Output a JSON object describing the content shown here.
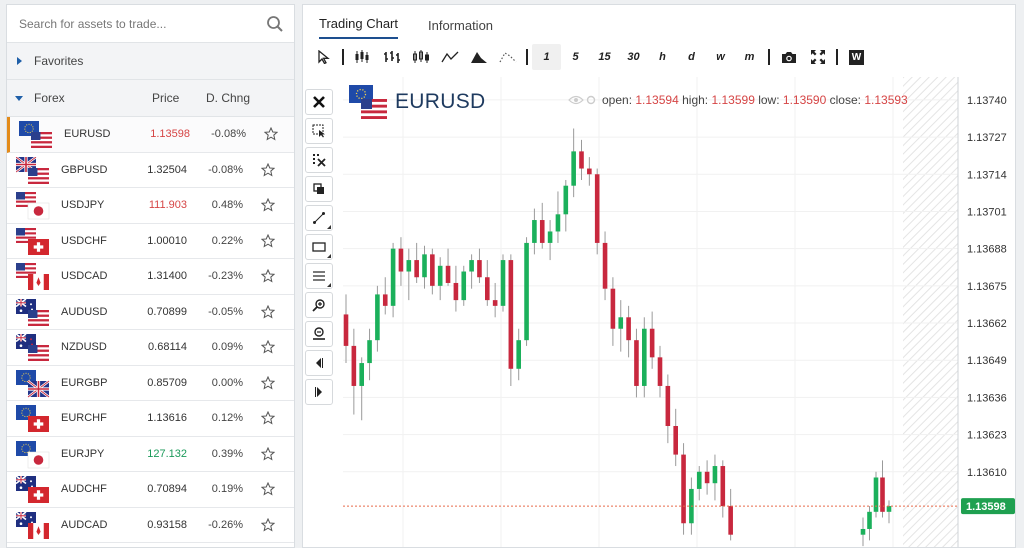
{
  "search": {
    "placeholder": "Search for assets to trade..."
  },
  "favorites_label": "Favorites",
  "forex": {
    "label": "Forex",
    "col_price": "Price",
    "col_change": "D. Chng",
    "rows": [
      {
        "symbol": "EURUSD",
        "price": "1.13598",
        "change": "-0.08%",
        "price_color": "red",
        "base": "EU",
        "quote": "US"
      },
      {
        "symbol": "GBPUSD",
        "price": "1.32504",
        "change": "-0.08%",
        "price_color": "none",
        "base": "GB",
        "quote": "US"
      },
      {
        "symbol": "USDJPY",
        "price": "111.903",
        "change": "0.48%",
        "price_color": "red",
        "base": "US",
        "quote": "JP"
      },
      {
        "symbol": "USDCHF",
        "price": "1.00010",
        "change": "0.22%",
        "price_color": "none",
        "base": "US",
        "quote": "CH"
      },
      {
        "symbol": "USDCAD",
        "price": "1.31400",
        "change": "-0.23%",
        "price_color": "none",
        "base": "US",
        "quote": "CA"
      },
      {
        "symbol": "AUDUSD",
        "price": "0.70899",
        "change": "-0.05%",
        "price_color": "none",
        "base": "AU",
        "quote": "US"
      },
      {
        "symbol": "NZDUSD",
        "price": "0.68114",
        "change": "0.09%",
        "price_color": "none",
        "base": "NZ",
        "quote": "US"
      },
      {
        "symbol": "EURGBP",
        "price": "0.85709",
        "change": "0.00%",
        "price_color": "none",
        "base": "EU",
        "quote": "GB"
      },
      {
        "symbol": "EURCHF",
        "price": "1.13616",
        "change": "0.12%",
        "price_color": "none",
        "base": "EU",
        "quote": "CH"
      },
      {
        "symbol": "EURJPY",
        "price": "127.132",
        "change": "0.39%",
        "price_color": "green",
        "base": "EU",
        "quote": "JP"
      },
      {
        "symbol": "AUDCHF",
        "price": "0.70894",
        "change": "0.19%",
        "price_color": "none",
        "base": "AU",
        "quote": "CH"
      },
      {
        "symbol": "AUDCAD",
        "price": "0.93158",
        "change": "-0.26%",
        "price_color": "none",
        "base": "AU",
        "quote": "CA"
      }
    ]
  },
  "tabs": [
    {
      "label": "Trading Chart",
      "active": true
    },
    {
      "label": "Information",
      "active": false
    }
  ],
  "toolbar": {
    "intervals": [
      "1",
      "5",
      "15",
      "30",
      "h",
      "d",
      "w",
      "m"
    ],
    "selected_interval": "1",
    "chart_types": [
      "candles-icon",
      "bars-icon",
      "hollow-candles-icon",
      "line-icon",
      "area-icon",
      "dotted-line-icon"
    ],
    "w_label": "W"
  },
  "chart_header": {
    "symbol": "EURUSD",
    "open_label": "open:",
    "open": "1.13594",
    "high_label": "high:",
    "high": "1.13599",
    "low_label": "low:",
    "low": "1.13590",
    "close_label": "close:",
    "close": "1.13593"
  },
  "colors": {
    "up": "#1bb05b",
    "down": "#c8283e",
    "current_price": "#1fa050",
    "accent": "#e38b1a"
  },
  "chart_data": {
    "type": "candlestick",
    "y_ticks": [
      "1.13740",
      "1.13727",
      "1.13714",
      "1.13701",
      "1.13688",
      "1.13675",
      "1.13662",
      "1.13649",
      "1.13636",
      "1.13623",
      "1.13610"
    ],
    "ylim": [
      1.13583,
      1.13748
    ],
    "current_price": "1.13598",
    "grid": true,
    "candles": [
      [
        1.13665,
        1.13672,
        1.13648,
        1.13654
      ],
      [
        1.13654,
        1.1366,
        1.1363,
        1.1364
      ],
      [
        1.1364,
        1.1365,
        1.13628,
        1.13648
      ],
      [
        1.13648,
        1.1366,
        1.13642,
        1.13656
      ],
      [
        1.13656,
        1.13675,
        1.13652,
        1.13672
      ],
      [
        1.13672,
        1.13678,
        1.13665,
        1.13668
      ],
      [
        1.13668,
        1.1369,
        1.13664,
        1.13688
      ],
      [
        1.13688,
        1.13692,
        1.13675,
        1.1368
      ],
      [
        1.1368,
        1.13688,
        1.1367,
        1.13684
      ],
      [
        1.13684,
        1.1369,
        1.13676,
        1.13678
      ],
      [
        1.13678,
        1.13689,
        1.13674,
        1.13686
      ],
      [
        1.13686,
        1.13688,
        1.13672,
        1.13675
      ],
      [
        1.13675,
        1.13685,
        1.1367,
        1.13682
      ],
      [
        1.13682,
        1.13688,
        1.13675,
        1.13676
      ],
      [
        1.13676,
        1.13682,
        1.13666,
        1.1367
      ],
      [
        1.1367,
        1.13682,
        1.13668,
        1.1368
      ],
      [
        1.1368,
        1.13686,
        1.13674,
        1.13684
      ],
      [
        1.13684,
        1.13688,
        1.13676,
        1.13678
      ],
      [
        1.13678,
        1.13684,
        1.13668,
        1.1367
      ],
      [
        1.1367,
        1.13676,
        1.13664,
        1.13668
      ],
      [
        1.13668,
        1.13686,
        1.13666,
        1.13684
      ],
      [
        1.13684,
        1.13686,
        1.1364,
        1.13646
      ],
      [
        1.13646,
        1.1366,
        1.13642,
        1.13656
      ],
      [
        1.13656,
        1.13692,
        1.13654,
        1.1369
      ],
      [
        1.1369,
        1.13702,
        1.13686,
        1.13698
      ],
      [
        1.13698,
        1.13704,
        1.13688,
        1.1369
      ],
      [
        1.1369,
        1.13698,
        1.13684,
        1.13694
      ],
      [
        1.13694,
        1.13708,
        1.1369,
        1.137
      ],
      [
        1.137,
        1.13712,
        1.13694,
        1.1371
      ],
      [
        1.1371,
        1.1373,
        1.13706,
        1.13722
      ],
      [
        1.13722,
        1.13726,
        1.13712,
        1.13716
      ],
      [
        1.13716,
        1.1372,
        1.1371,
        1.13714
      ],
      [
        1.13714,
        1.13716,
        1.13686,
        1.1369
      ],
      [
        1.1369,
        1.13694,
        1.1367,
        1.13674
      ],
      [
        1.13674,
        1.13678,
        1.13654,
        1.1366
      ],
      [
        1.1366,
        1.1367,
        1.13652,
        1.13664
      ],
      [
        1.13664,
        1.13668,
        1.1365,
        1.13656
      ],
      [
        1.13656,
        1.1366,
        1.13636,
        1.1364
      ],
      [
        1.1364,
        1.13664,
        1.13636,
        1.1366
      ],
      [
        1.1366,
        1.13666,
        1.13646,
        1.1365
      ],
      [
        1.1365,
        1.13654,
        1.13636,
        1.1364
      ],
      [
        1.1364,
        1.13644,
        1.1362,
        1.13626
      ],
      [
        1.13626,
        1.13632,
        1.13612,
        1.13616
      ],
      [
        1.13616,
        1.1362,
        1.13588,
        1.13592
      ],
      [
        1.13592,
        1.13608,
        1.13588,
        1.13604
      ],
      [
        1.13604,
        1.13612,
        1.136,
        1.1361
      ],
      [
        1.1361,
        1.13614,
        1.13602,
        1.13606
      ],
      [
        1.13606,
        1.13616,
        1.136,
        1.13612
      ],
      [
        1.13612,
        1.13614,
        1.13594,
        1.13598
      ],
      [
        1.13598,
        1.13604,
        1.13586,
        1.13588
      ]
    ],
    "tail_candles": [
      [
        1.13588,
        1.13594,
        1.13584,
        1.1359
      ],
      [
        1.1359,
        1.13598,
        1.13586,
        1.13596
      ],
      [
        1.13596,
        1.1361,
        1.13594,
        1.13608
      ],
      [
        1.13608,
        1.13614,
        1.13594,
        1.13596
      ],
      [
        1.13596,
        1.136,
        1.13592,
        1.13598
      ]
    ]
  }
}
